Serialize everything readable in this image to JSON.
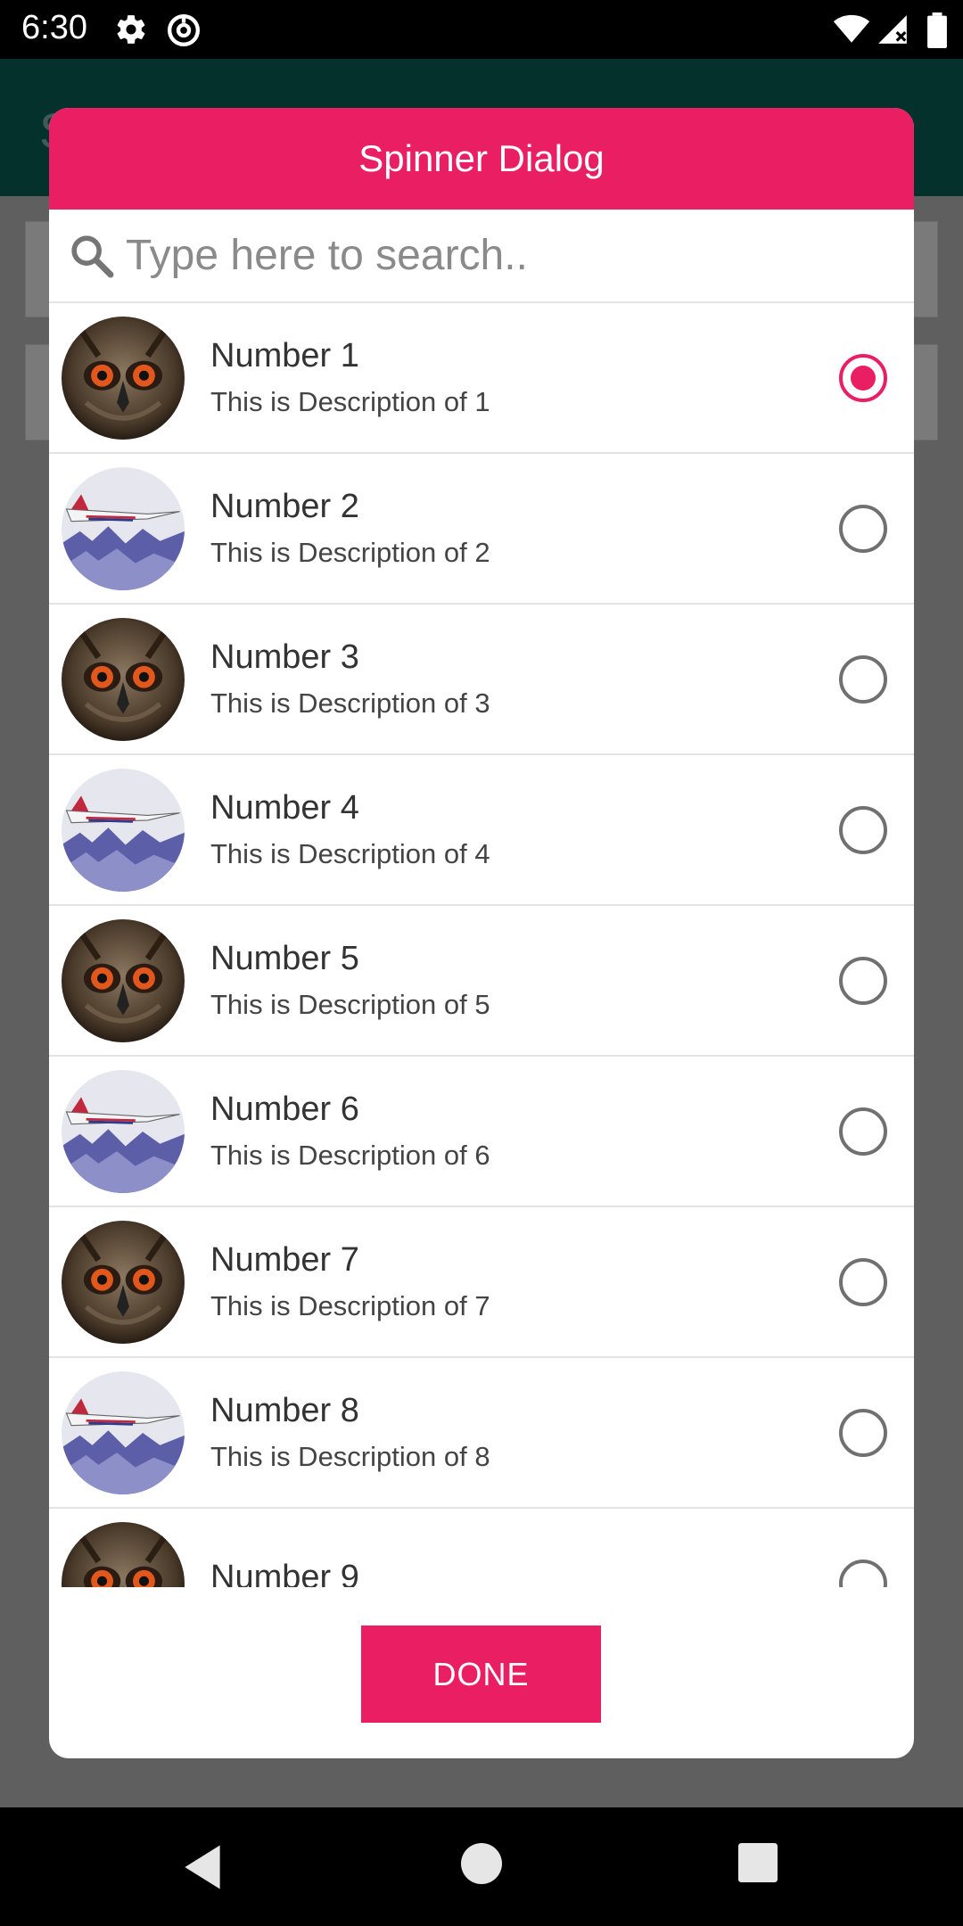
{
  "status_bar": {
    "time": "6:30",
    "icons": [
      "gear-icon",
      "at-sign-icon",
      "wifi-icon",
      "signal-icon",
      "battery-icon"
    ]
  },
  "app_bar": {
    "title_fragment": "S"
  },
  "dialog": {
    "title": "Spinner Dialog",
    "search": {
      "placeholder": "Type here to search..",
      "value": ""
    },
    "items": [
      {
        "title": "Number 1",
        "description": "This is Description of 1",
        "image": "owl",
        "selected": true
      },
      {
        "title": "Number 2",
        "description": "This is Description of 2",
        "image": "jet",
        "selected": false
      },
      {
        "title": "Number 3",
        "description": "This is Description of 3",
        "image": "owl",
        "selected": false
      },
      {
        "title": "Number 4",
        "description": "This is Description of 4",
        "image": "jet",
        "selected": false
      },
      {
        "title": "Number 5",
        "description": "This is Description of 5",
        "image": "owl",
        "selected": false
      },
      {
        "title": "Number 6",
        "description": "This is Description of 6",
        "image": "jet",
        "selected": false
      },
      {
        "title": "Number 7",
        "description": "This is Description of 7",
        "image": "owl",
        "selected": false
      },
      {
        "title": "Number 8",
        "description": "This is Description of 8",
        "image": "jet",
        "selected": false
      },
      {
        "title": "Number 9",
        "description": "",
        "image": "owl",
        "selected": false
      }
    ],
    "done_label": "DONE",
    "accent_color": "#e91e63"
  },
  "nav_bar": {
    "icons": [
      "back-icon",
      "home-icon",
      "recents-icon"
    ]
  }
}
